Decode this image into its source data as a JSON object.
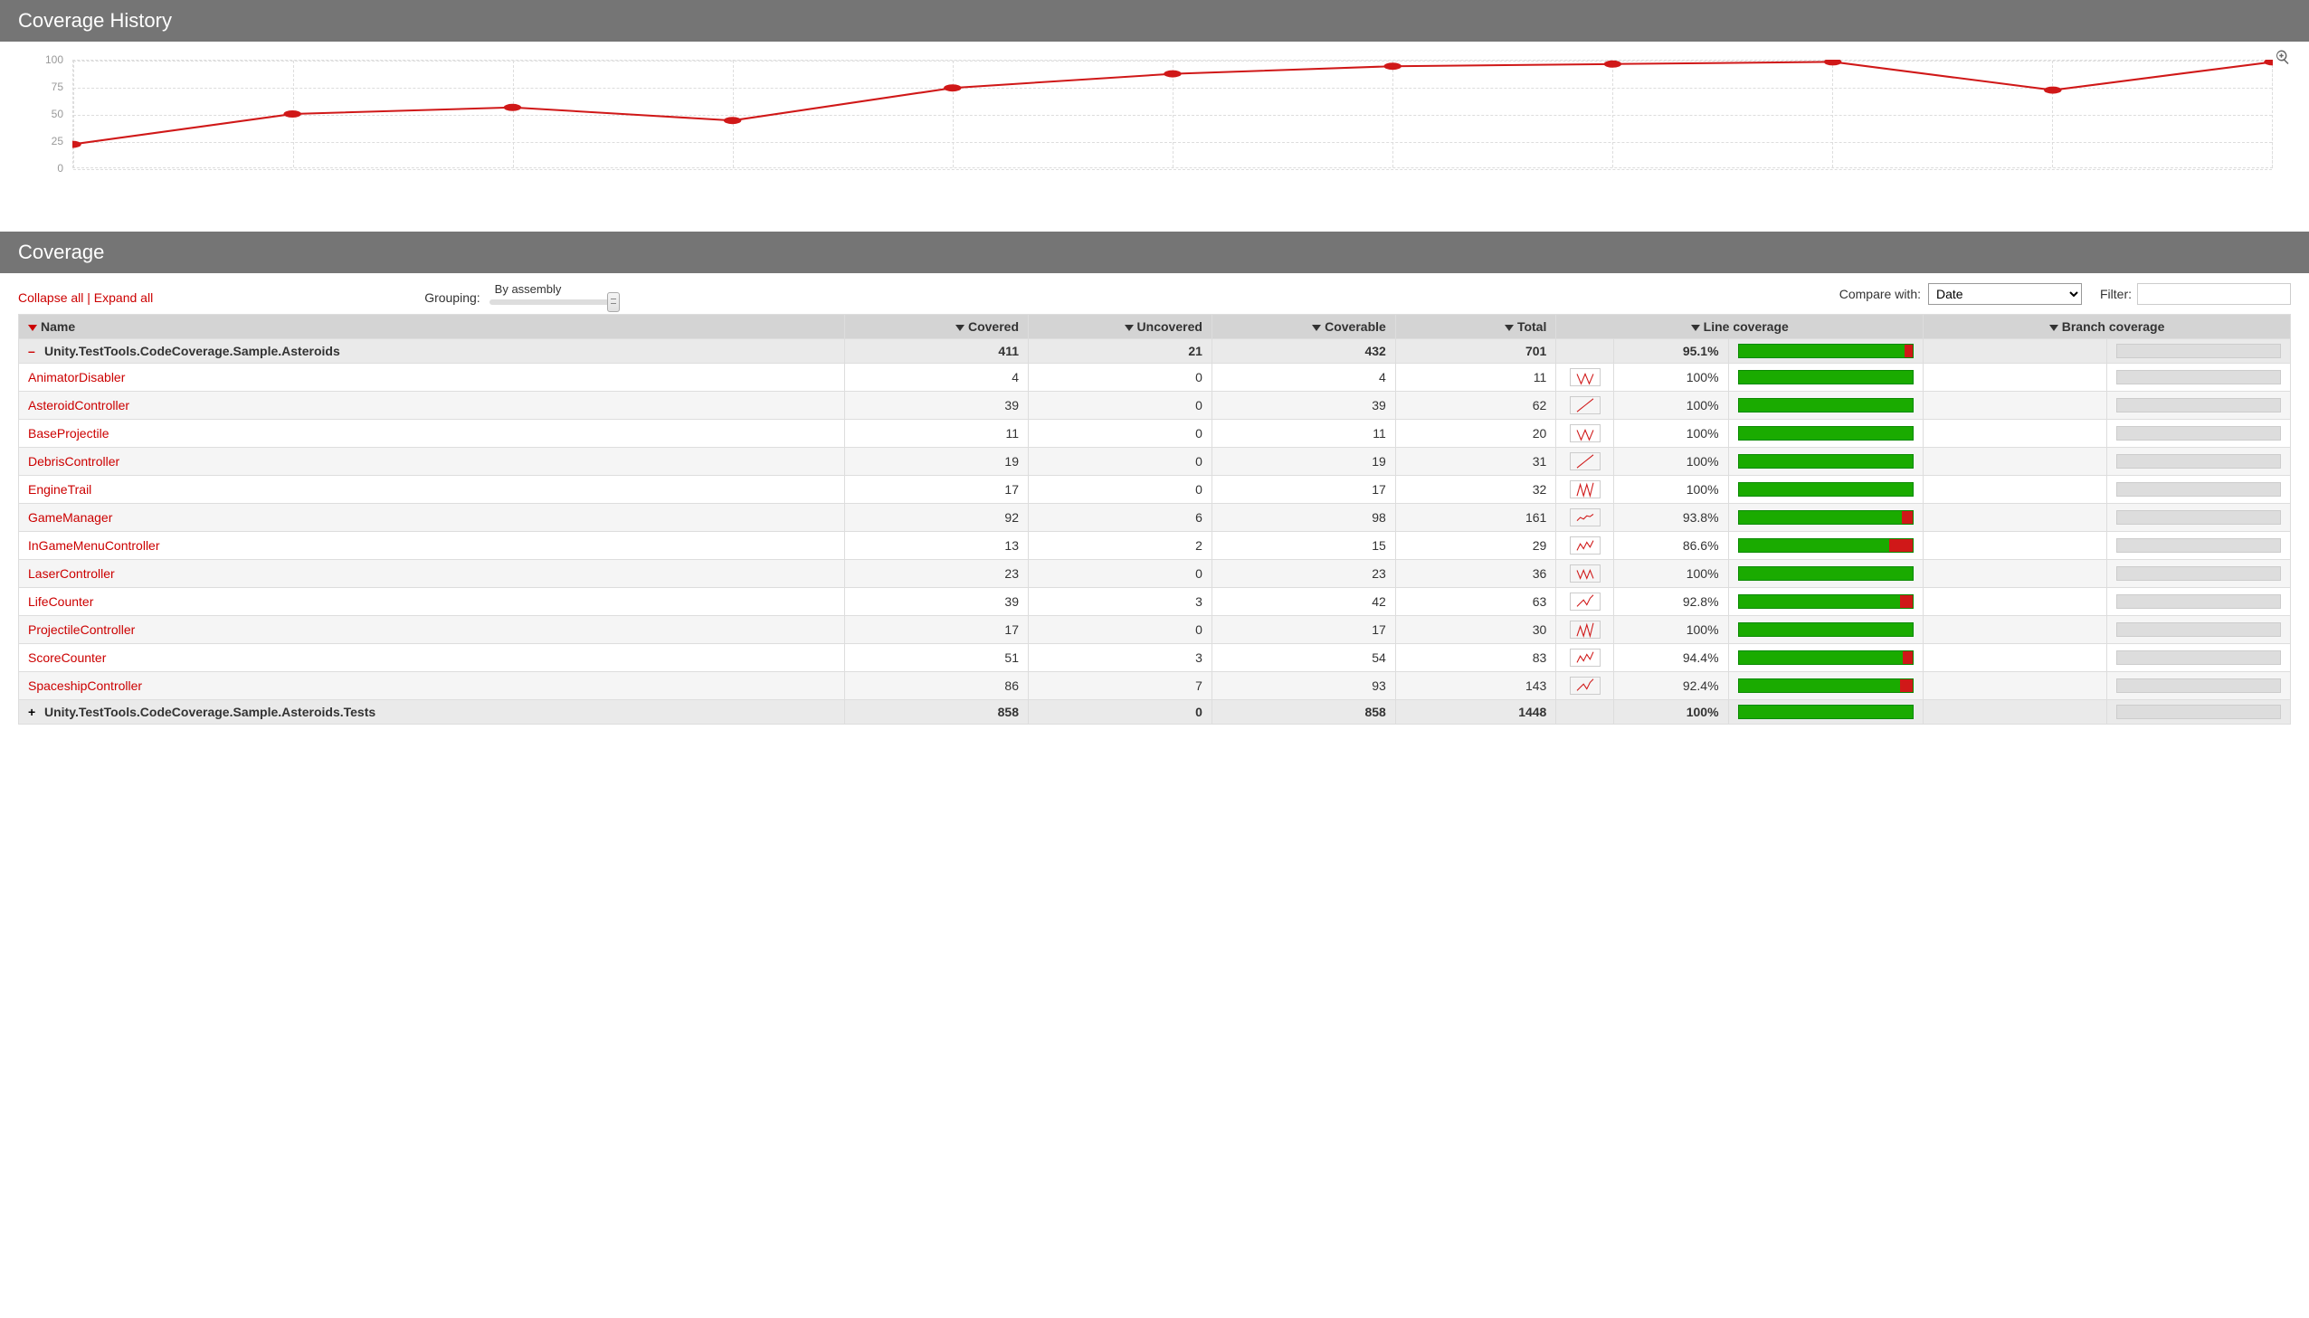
{
  "sections": {
    "history_title": "Coverage History",
    "coverage_title": "Coverage"
  },
  "chart_data": {
    "type": "line",
    "title": "Coverage History",
    "ylabel": "",
    "ylim": [
      0,
      100
    ],
    "yticks": [
      0,
      25,
      50,
      75,
      100
    ],
    "values": [
      22,
      50,
      56,
      44,
      74,
      87,
      94,
      96,
      98,
      72,
      98
    ]
  },
  "controls": {
    "collapse_all": "Collapse all",
    "expand_all": "Expand all",
    "grouping_label": "Grouping:",
    "grouping_mode": "By assembly",
    "compare_label": "Compare with:",
    "compare_value": "Date",
    "filter_label": "Filter:",
    "filter_value": ""
  },
  "table": {
    "headers": {
      "name": "Name",
      "covered": "Covered",
      "uncovered": "Uncovered",
      "coverable": "Coverable",
      "total": "Total",
      "line_coverage": "Line coverage",
      "branch_coverage": "Branch coverage"
    },
    "rows": [
      {
        "type": "assembly",
        "icon": "-",
        "name": "Unity.TestTools.CodeCoverage.Sample.Asteroids",
        "covered": 411,
        "uncovered": 21,
        "coverable": 432,
        "total": 701,
        "pct": "95.1%",
        "red_pct": 4.9
      },
      {
        "type": "class",
        "name": "AnimatorDisabler",
        "covered": 4,
        "uncovered": 0,
        "coverable": 4,
        "total": 11,
        "pct": "100%",
        "red_pct": 0,
        "spark": [
          30,
          90,
          30,
          90,
          30
        ]
      },
      {
        "type": "class",
        "alt": true,
        "name": "AsteroidController",
        "covered": 39,
        "uncovered": 0,
        "coverable": 39,
        "total": 62,
        "pct": "100%",
        "red_pct": 0,
        "spark": [
          90,
          70,
          50,
          30,
          10
        ]
      },
      {
        "type": "class",
        "name": "BaseProjectile",
        "covered": 11,
        "uncovered": 0,
        "coverable": 11,
        "total": 20,
        "pct": "100%",
        "red_pct": 0,
        "spark": [
          30,
          90,
          30,
          90,
          30
        ]
      },
      {
        "type": "class",
        "alt": true,
        "name": "DebrisController",
        "covered": 19,
        "uncovered": 0,
        "coverable": 19,
        "total": 31,
        "pct": "100%",
        "red_pct": 0,
        "spark": [
          90,
          70,
          50,
          30,
          10
        ]
      },
      {
        "type": "class",
        "name": "EngineTrail",
        "covered": 17,
        "uncovered": 0,
        "coverable": 17,
        "total": 32,
        "pct": "100%",
        "red_pct": 0,
        "spark": [
          90,
          20,
          90,
          20,
          90,
          10
        ]
      },
      {
        "type": "class",
        "alt": true,
        "name": "GameManager",
        "covered": 92,
        "uncovered": 6,
        "coverable": 98,
        "total": 161,
        "pct": "93.8%",
        "red_pct": 6.2,
        "spark": [
          70,
          50,
          60,
          40,
          45,
          30
        ]
      },
      {
        "type": "class",
        "name": "InGameMenuController",
        "covered": 13,
        "uncovered": 2,
        "coverable": 15,
        "total": 29,
        "pct": "86.6%",
        "red_pct": 13.4,
        "spark": [
          80,
          40,
          70,
          30,
          60,
          20
        ]
      },
      {
        "type": "class",
        "alt": true,
        "name": "LaserController",
        "covered": 23,
        "uncovered": 0,
        "coverable": 23,
        "total": 36,
        "pct": "100%",
        "red_pct": 0,
        "spark": [
          30,
          80,
          30,
          80,
          30,
          80
        ]
      },
      {
        "type": "class",
        "name": "LifeCounter",
        "covered": 39,
        "uncovered": 3,
        "coverable": 42,
        "total": 63,
        "pct": "92.8%",
        "red_pct": 7.2,
        "spark": [
          80,
          60,
          40,
          70,
          30,
          10
        ]
      },
      {
        "type": "class",
        "alt": true,
        "name": "ProjectileController",
        "covered": 17,
        "uncovered": 0,
        "coverable": 17,
        "total": 30,
        "pct": "100%",
        "red_pct": 0,
        "spark": [
          90,
          30,
          90,
          20,
          90,
          10
        ]
      },
      {
        "type": "class",
        "name": "ScoreCounter",
        "covered": 51,
        "uncovered": 3,
        "coverable": 54,
        "total": 83,
        "pct": "94.4%",
        "red_pct": 5.6,
        "spark": [
          80,
          40,
          70,
          30,
          60,
          15
        ]
      },
      {
        "type": "class",
        "alt": true,
        "name": "SpaceshipController",
        "covered": 86,
        "uncovered": 7,
        "coverable": 93,
        "total": 143,
        "pct": "92.4%",
        "red_pct": 7.6,
        "spark": [
          80,
          60,
          40,
          70,
          30,
          10
        ]
      },
      {
        "type": "assembly",
        "icon": "+",
        "name": "Unity.TestTools.CodeCoverage.Sample.Asteroids.Tests",
        "covered": 858,
        "uncovered": 0,
        "coverable": 858,
        "total": 1448,
        "pct": "100%",
        "red_pct": 0
      }
    ]
  }
}
